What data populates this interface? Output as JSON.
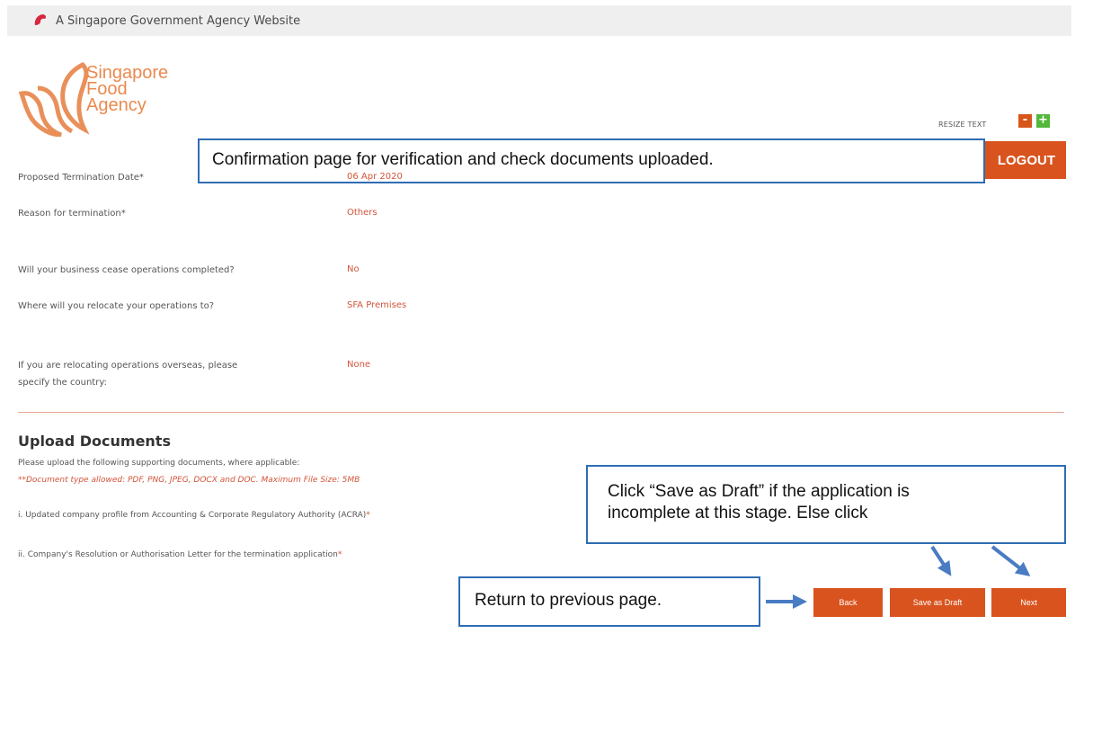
{
  "gov_banner": {
    "text": "A Singapore Government Agency Website"
  },
  "logo": {
    "line1": "Singapore",
    "line2": "Food",
    "line3": "Agency"
  },
  "header": {
    "resize_label": "RESIZE TEXT",
    "resize_minus": "-",
    "resize_plus": "+",
    "logout_label": "LOGOUT"
  },
  "callouts": {
    "top": "Confirmation page for verification and check documents uploaded.",
    "draft_line1": "Click “Save as Draft” if the application is",
    "draft_line2": "incomplete at this stage. Else click",
    "back": "Return to previous page."
  },
  "fields": [
    {
      "label": "Proposed Termination Date*",
      "value": "06 Apr 2020"
    },
    {
      "label": "Reason for termination*",
      "value": "Others"
    },
    {
      "label": "Will your business cease operations completed?",
      "value": "No"
    },
    {
      "label": "Where will you relocate your operations to?",
      "value": "SFA Premises"
    },
    {
      "label_line1": "If you are relocating operations overseas, please",
      "label_line2": "specify the country:",
      "value": "None"
    }
  ],
  "upload": {
    "title": "Upload Documents",
    "intro": "Please upload the following supporting documents, where applicable:",
    "note": "**Document type allowed: PDF, PNG, JPEG, DOCX and DOC. Maximum File Size: 5MB",
    "doc1": "i. Updated company profile from Accounting & Corporate Regulatory Authority (ACRA)",
    "doc2": "ii. Company's Resolution or Authorisation Letter for the termination application",
    "required_mark": "*"
  },
  "buttons": {
    "back": "Back",
    "save_draft": "Save as Draft",
    "next": "Next"
  },
  "colors": {
    "accent": "#d9531e",
    "annotation_border": "#2f6db2",
    "value_text": "#d2553a",
    "plus_button": "#53b83a"
  }
}
